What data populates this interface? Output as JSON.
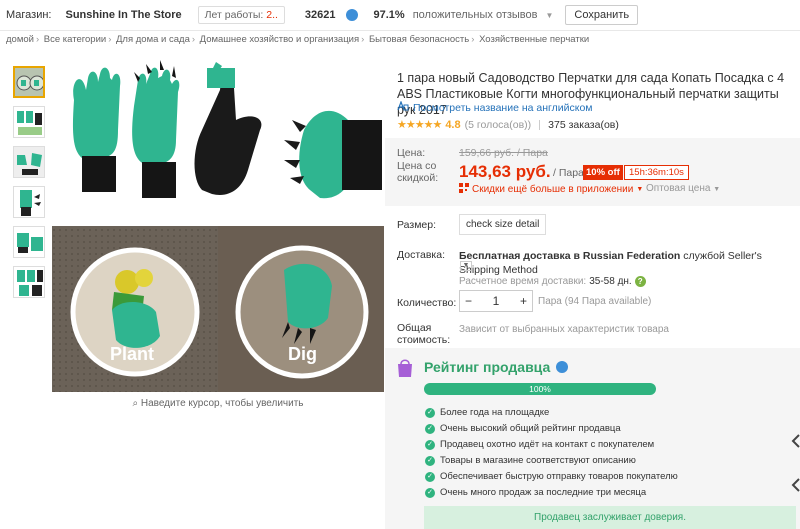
{
  "topbar": {
    "store_label": "Магазин:",
    "store_name": "Sunshine In The Store",
    "years_label": "Лет работы:",
    "years_value": "2..",
    "score": "32621",
    "positive_pct": "97.1%",
    "positive_label": "положительных отзывов",
    "save_label": "Сохранить"
  },
  "breadcrumbs": [
    "домой",
    "Все категории",
    "Для дома и сада",
    "Домашнее хозяйство и организация",
    "Бытовая безопасность",
    "Хозяйственные перчатки"
  ],
  "gallery": {
    "zoom_hint": "Наведите курсор, чтобы увеличить",
    "plant_label": "Plant",
    "dig_label": "Dig"
  },
  "product": {
    "title": "1 пара новый Садоводство Перчатки для сада Копать Посадка с 4 ABS Пластиковые Когти многофункциональный перчатки защиты рук 2017",
    "translate_link": "Посмотреть название на английском",
    "rating_value": "4.8",
    "votes": "(5 голоса(ов))",
    "orders": "375 заказа(ов)",
    "rating_stars": 4.8
  },
  "price": {
    "price_label": "Цена:",
    "old_price": "159,66 руб. / Пара",
    "discount_label_1": "Цена со",
    "discount_label_2": "скидкой:",
    "new_price": "143,63 руб.",
    "per_unit": "/ Пара",
    "off_badge": "10% off",
    "timer": "15h:36m:10s",
    "app_discount": "Скидки ещё больше в приложении",
    "wholesale": "Оптовая цена"
  },
  "options": {
    "size_label": "Размер:",
    "size_button": "check size detail",
    "shipping_label": "Доставка:",
    "shipping_text_bold": "Бесплатная доставка в Russian Federation",
    "shipping_text": " службой Seller's Shipping Method",
    "delivery_label": "Расчетное время доставки:",
    "delivery_value": "35-58 дн.",
    "quantity_label": "Количество:",
    "quantity_value": "1",
    "minus": "−",
    "plus": "+",
    "available": "Пара (94 Пара available)",
    "total_label_1": "Общая",
    "total_label_2": "стоимость:",
    "total_value": "Зависит от выбранных характеристик товара"
  },
  "seller": {
    "title": "Рейтинг продавца",
    "bar_value": "100%",
    "bar_fraction": 1.0,
    "features": [
      "Более года на площадке",
      "Очень высокий общий рейтинг продавца",
      "Продавец охотно идёт на контакт с покупателем",
      "Товары в магазине соответствуют описанию",
      "Обеспечивает быструю отправку товаров покупателю",
      "Очень много продаж за последние три месяца"
    ],
    "trust": "Продавец заслуживает доверия."
  },
  "colors": {
    "accent_red": "#e62e04",
    "seller_green": "#33a26b",
    "glove_teal": "#2fb590"
  }
}
